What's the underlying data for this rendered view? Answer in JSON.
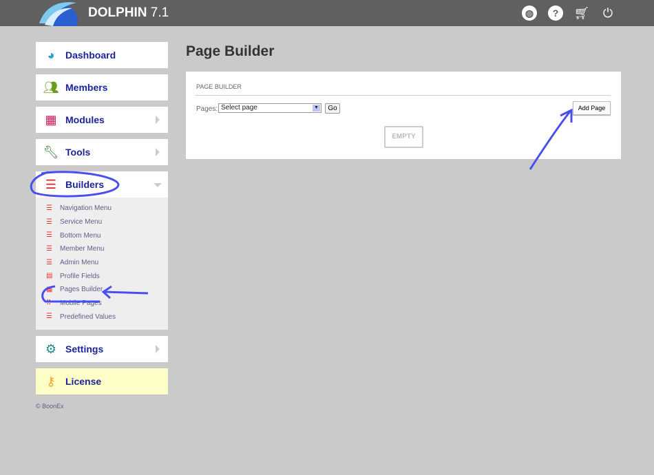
{
  "header": {
    "brand": "DOLPHIN",
    "version": "7.1",
    "icons": [
      "globe-icon",
      "help-icon",
      "cart-icon",
      "power-icon"
    ]
  },
  "sidebar": {
    "items": [
      {
        "label": "Dashboard",
        "icon": "dashboard-icon",
        "color": "#2a9fd6"
      },
      {
        "label": "Members",
        "icon": "members-icon",
        "color": "#6a9b1e"
      },
      {
        "label": "Modules",
        "icon": "modules-icon",
        "color": "#d0165a"
      },
      {
        "label": "Tools",
        "icon": "wrench-icon",
        "color": "#2a7a2a"
      },
      {
        "label": "Builders",
        "icon": "builders-icon",
        "color": "#e82020"
      },
      {
        "label": "Settings",
        "icon": "gears-icon",
        "color": "#1a8a8a"
      },
      {
        "label": "License",
        "icon": "key-icon",
        "color": "#f0a020"
      }
    ],
    "builders_sub": [
      "Navigation Menu",
      "Service Menu",
      "Bottom Menu",
      "Member Menu",
      "Admin Menu",
      "Profile Fields",
      "Pages Builder",
      "Mobile Pages",
      "Predefined Values"
    ],
    "copyright": "© BoonEx"
  },
  "main": {
    "title": "Page Builder",
    "panel_title": "PAGE BUILDER",
    "pages_label": "Pages:",
    "select_value": "Select page",
    "go_label": "Go",
    "add_label": "Add Page",
    "empty_label": "EMPTY"
  },
  "colors": {
    "topbar": "#606060",
    "nav_text": "#1a239a",
    "annotation": "#4a4ef0"
  }
}
